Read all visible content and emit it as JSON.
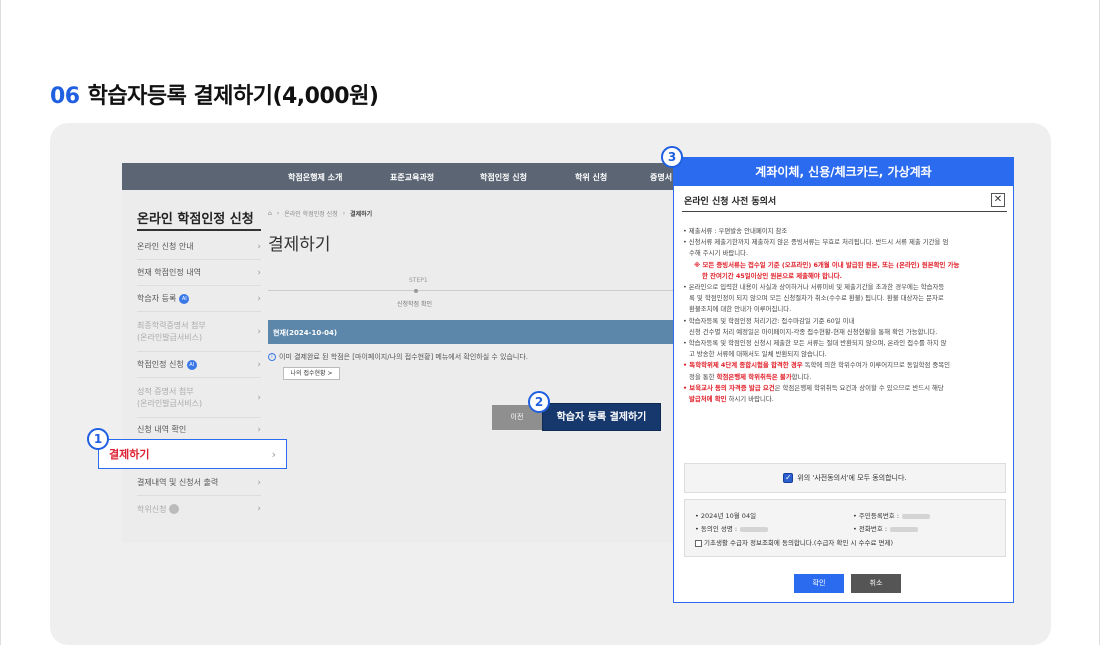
{
  "section": {
    "number": "06",
    "title": "학습자등록 결제하기(4,000원)"
  },
  "topnav": {
    "items": [
      "학점은행제 소개",
      "표준교육과정",
      "학점인정 신청",
      "학위 신청",
      "증명서"
    ]
  },
  "sidebar": {
    "title": "온라인 학점인정 신청",
    "items": [
      {
        "label": "온라인 신청 안내"
      },
      {
        "label": "현재 학점인정 내역"
      },
      {
        "label": "학습자 등록",
        "badge": "AI"
      },
      {
        "label": "최종학력증명서 첨부",
        "label2": "(온라인발급서비스)"
      },
      {
        "label": "학점인정 신청",
        "badge": "AI"
      },
      {
        "label": "성적 증명서 첨부",
        "label2": "(온라인발급서비스)"
      },
      {
        "label": "신청 내역 확인"
      },
      {
        "label": "결제하기"
      },
      {
        "label": "결제내역 및 신청서 출력"
      },
      {
        "label": "학위신청"
      }
    ]
  },
  "breadcrumb": {
    "level1": "온라인 학점인정 신청",
    "level2": "결제하기"
  },
  "main": {
    "title": "결제하기",
    "step_label": "STEP1",
    "step_name": "신청학점 확인",
    "current": "현재(2024-10-04)",
    "info": "이미 결제완료 된 학점은 [마이페이지/나의 접수현황] 메뉴에서 확인하실 수 있습니다.",
    "my_status_button": "나의 접수현황 >",
    "prev_button": "이전",
    "pay_button": "학습자 등록 결제하기"
  },
  "callouts": [
    "1",
    "2",
    "3"
  ],
  "modal": {
    "header": "계좌이체, 신용/체크카드, 가상계좌",
    "title": "온라인 신청 사전 동의서",
    "close": "✕",
    "terms": {
      "t1": "• 제출서류 : 우편발송 안내페이지 참조",
      "t2a": "• 신청서류 제출기한까지 제출하지 않은 증빙서류는 무효로 처리됩니다. 반드시 서류 제출 기간을 엄",
      "t2b": "수해 주시기 바랍니다.",
      "t2red1": "※ 모든 증빙서류는 접수일 기준 (오프라인) 6개월 이내 발급된 원본, 또는 (온라인) 원본확인 가능",
      "t2red2": "한 잔여기간 45일이상인 원본으로 제출해야 합니다.",
      "t3a": "• 온라인으로 입력한 내용이 사실과 상이하거나 서류미비 및 제출기간을 초과한 경우에는 학습자등",
      "t3b": "록 및 학점인정이 되지 않으며 모든 신청절차가 취소(수수료 환불) 됩니다. 환불 대상자는 문자로",
      "t3c": "환불조치에 대한 안내가 이루어집니다.",
      "t4a": "• 학습자등록 및 학점인정 처리기간: 접수마감일 기준 60일 이내",
      "t4b": "신청 건수별 처리 예정일은 마이페이지-각종 접수현황-현재 신청현황을 통해 확인 가능합니다.",
      "t5a": "• 학습자등록 및 학점인정 신청시 제출한 모든 서류는 절대 반환되지 않으며, 온라인 접수를 하지 않",
      "t5b": "고 방송한 서류에 대해서도 일체 반환되지 않습니다.",
      "t6a_red": "• 독학학위제 4단계 종합시험을 합격한 경우",
      "t6a": " 독학에 의한 학위수여가 이루어지므로 동일학점 중복인",
      "t6b": "정을 통한 ",
      "t6b_red": "학점은행제 학위취득은 불가",
      "t6b_end": "합니다.",
      "t7a_red": "• 보육교사 등의 자격증 발급 요건",
      "t7a": "은 학점은행제 학위취득 요건과 상이할 수 있으므로 반드시 해당",
      "t7b_red": "발급처에 확인",
      "t7b": " 하시기 바랍니다."
    },
    "agree_text": "위의 '사전동의서'에 모두 동의합니다.",
    "info": {
      "date": "• 2024년 10월 04일",
      "name_label": "• 동의인 성명 :",
      "rrn_label": "• 주민등록번호 :",
      "phone_label": "• 전화번호 :",
      "consent": "기초생활 수급자 정보조회에 동의합니다.(수급자 확인 시 수수료 면제)"
    },
    "ok_button": "확인",
    "cancel_button": "취소"
  }
}
